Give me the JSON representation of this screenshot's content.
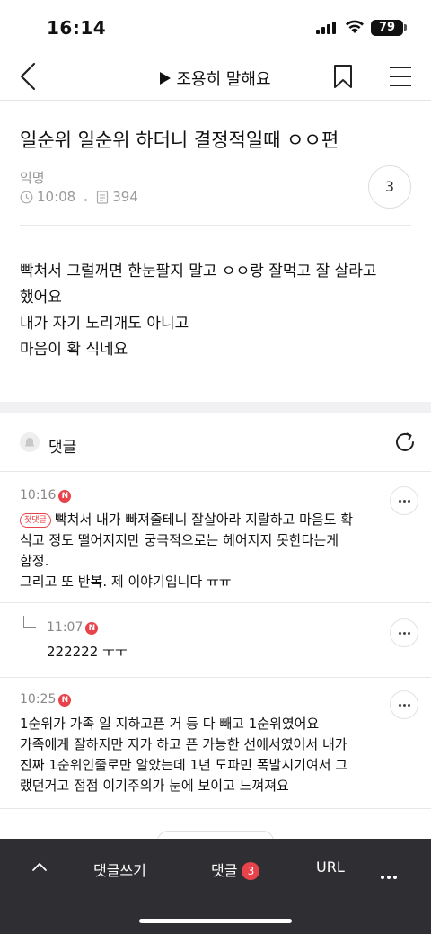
{
  "status_bar": {
    "time": "16:14",
    "battery": "79"
  },
  "nav": {
    "board_title": "조용히 말해요"
  },
  "post": {
    "title": "일순위 일순위 하더니 결정적일때 ㅇㅇ편",
    "author": "익명",
    "time": "10:08",
    "views": "394",
    "comment_count": "3",
    "body": [
      "빡쳐서 그럴꺼면 한눈팔지 말고 ㅇㅇ랑 잘먹고 잘 살라고",
      "했어요",
      "내가 자기 노리개도 아니고",
      "마음이 확 식네요"
    ]
  },
  "comments_section": {
    "label": "댓글"
  },
  "comments": [
    {
      "time": "10:16",
      "badge": "N",
      "first_label": "첫댓글",
      "lines": [
        "빡쳐서 내가 빠져줄테니 잘살아라 지랄하고 마음도 확",
        "식고 정도 떨어지지만 궁극적으로는 헤어지지 못한다는게",
        "함정.",
        "그리고 또 반복. 제 이야기입니다 ㅠㅠ"
      ]
    },
    {
      "time": "11:07",
      "badge": "N",
      "lines": [
        "222222 ㅜㅜ"
      ]
    },
    {
      "time": "10:25",
      "badge": "N",
      "lines": [
        "1순위가 가족 일 지하고픈 거 등 다 빼고 1순위였어요",
        "가족에게 잘하지만 지가 하고 픈 가능한 선에서였어서 내가",
        "진짜 1순위인줄로만 알았는데 1년 도파민 폭발시기여서 그",
        "랬던거고 점점 이기주의가 눈에 보이고 느껴져요"
      ]
    }
  ],
  "toolbar": {
    "write_label": "댓글쓰기",
    "comments_label": "댓글",
    "comments_count": "3",
    "url_label": "URL"
  },
  "colors": {
    "accent": "#e8434a",
    "toolbar_bg": "#2f2f33"
  }
}
